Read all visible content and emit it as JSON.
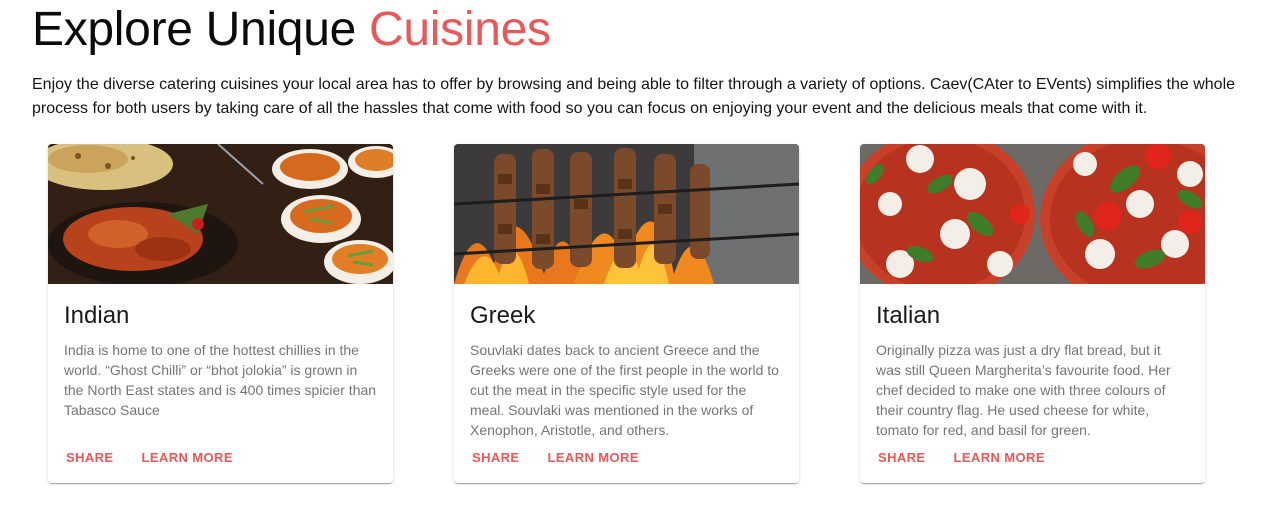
{
  "header": {
    "title_plain": "Explore Unique",
    "title_accent": "Cuisines",
    "accent_color": "#e85a5a",
    "intro": "Enjoy the diverse catering cuisines your local area has to offer by browsing and being able to filter through a variety of options. Caev(CAter to EVents) simplifies the whole process for both users by taking care of all the hassles that come with food so you can focus on enjoying your event and the delicious meals that come with it."
  },
  "cards": [
    {
      "title": "Indian",
      "text": "India is home to one of the hottest chillies in the world. “Ghost Chilli” or “bhot jolokia” is grown in the North East states and is 400 times spicier than Tabasco Sauce",
      "share_label": "Share",
      "learn_label": "Learn More"
    },
    {
      "title": "Greek",
      "text": "Souvlaki dates back to ancient Greece and the Greeks were one of the first people in the world to cut the meat in the specific style used for the meal. Souvlaki was mentioned in the works of Xenophon, Aristotle, and others.",
      "share_label": "Share",
      "learn_label": "Learn More"
    },
    {
      "title": "Italian",
      "text": "Originally pizza was just a dry flat bread, but it was still Queen Margherita’s favourite food. Her chef decided to make one with three colours of their country flag. He used cheese for white, tomato for red, and basil for green.",
      "share_label": "Share",
      "learn_label": "Learn More"
    }
  ]
}
